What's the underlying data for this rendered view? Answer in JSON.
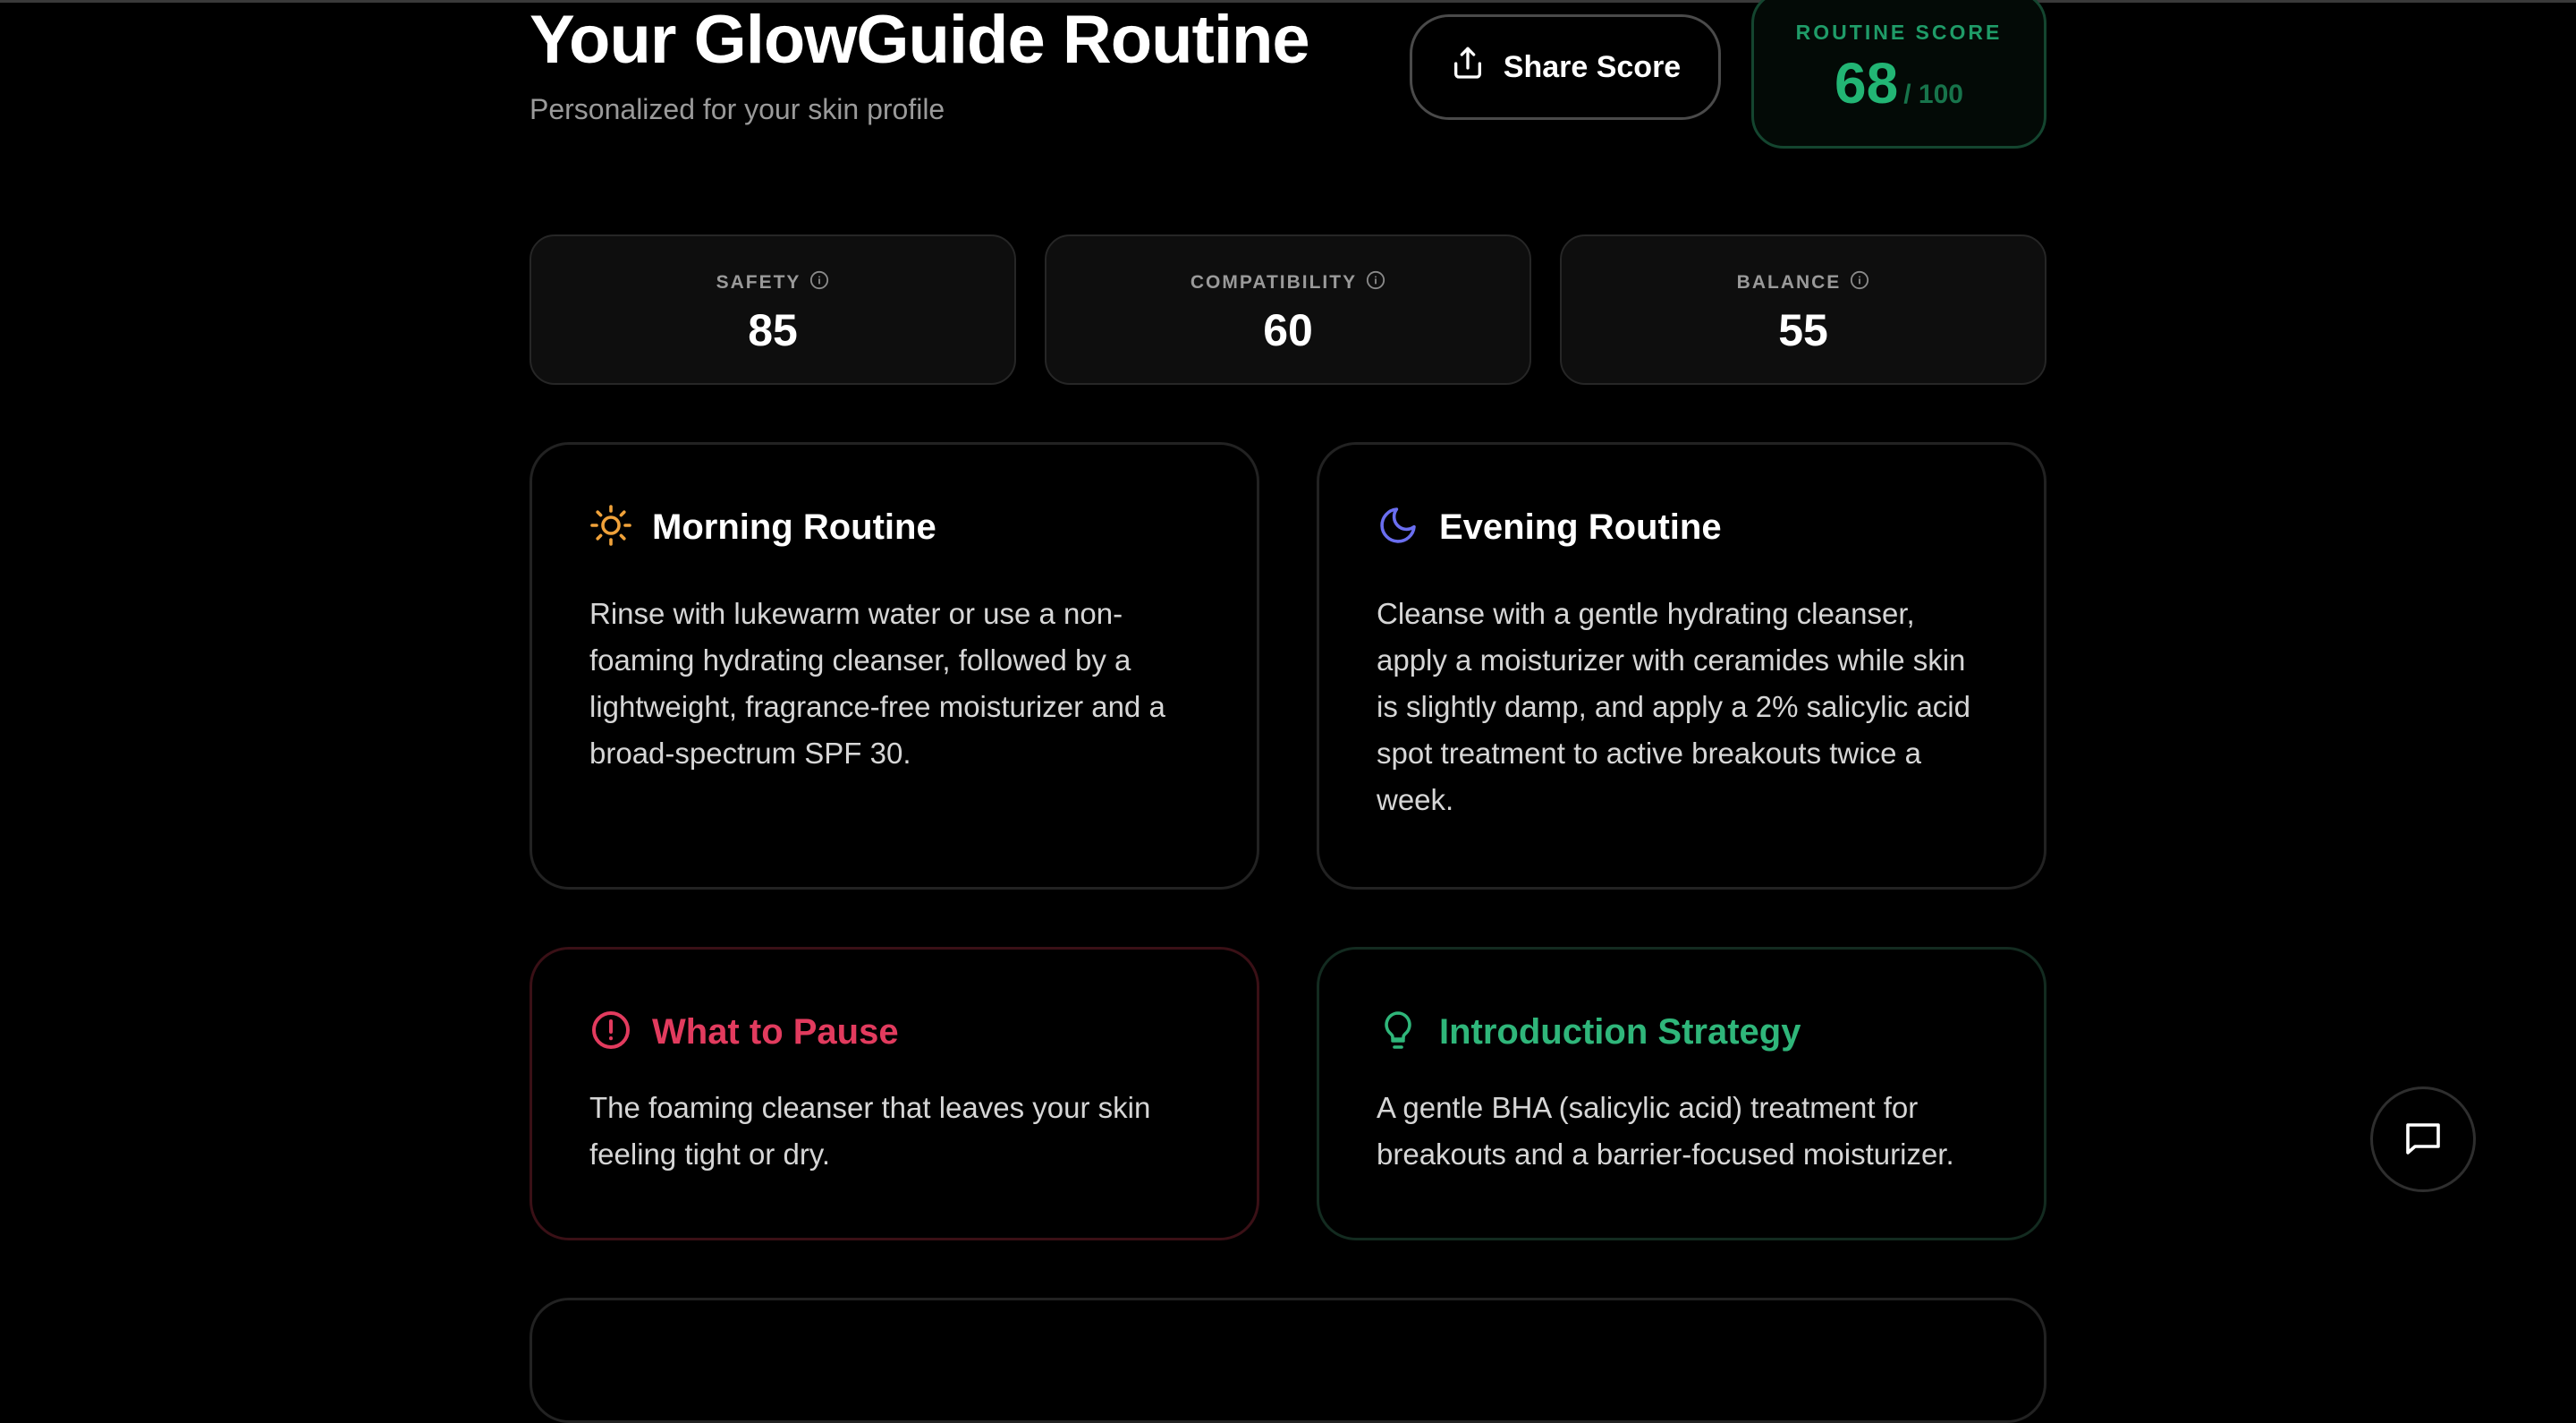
{
  "header": {
    "title": "Your GlowGuide Routine",
    "subtitle": "Personalized for your skin profile",
    "share_label": "Share Score"
  },
  "routine_score": {
    "label": "ROUTINE SCORE",
    "value": "68",
    "max": "/ 100",
    "color": "#22b574"
  },
  "metrics": [
    {
      "label": "SAFETY",
      "value": "85"
    },
    {
      "label": "COMPATIBILITY",
      "value": "60"
    },
    {
      "label": "BALANCE",
      "value": "55"
    }
  ],
  "morning": {
    "title": "Morning Routine",
    "icon": "sun-icon",
    "text": "Rinse with lukewarm water or use a non-foaming hydrating cleanser, followed by a lightweight, fragrance-free moisturizer and a broad-spectrum SPF 30."
  },
  "evening": {
    "title": "Evening Routine",
    "icon": "moon-icon",
    "text": "Cleanse with a gentle hydrating cleanser, apply a moisturizer with ceramides while skin is slightly damp, and apply a 2% salicylic acid spot treatment to active breakouts twice a week."
  },
  "pause": {
    "title": "What to Pause",
    "icon": "alert-circle-icon",
    "text": "The foaming cleanser that leaves your skin feeling tight or dry.",
    "color": "#e23b5e"
  },
  "introduction": {
    "title": "Introduction Strategy",
    "icon": "lightbulb-icon",
    "text": "A gentle BHA (salicylic acid) treatment for breakouts and a barrier-focused moisturizer.",
    "color": "#2fb67a"
  },
  "icons": {
    "share": "share-icon",
    "info": "info-icon",
    "chat": "chat-icon"
  }
}
